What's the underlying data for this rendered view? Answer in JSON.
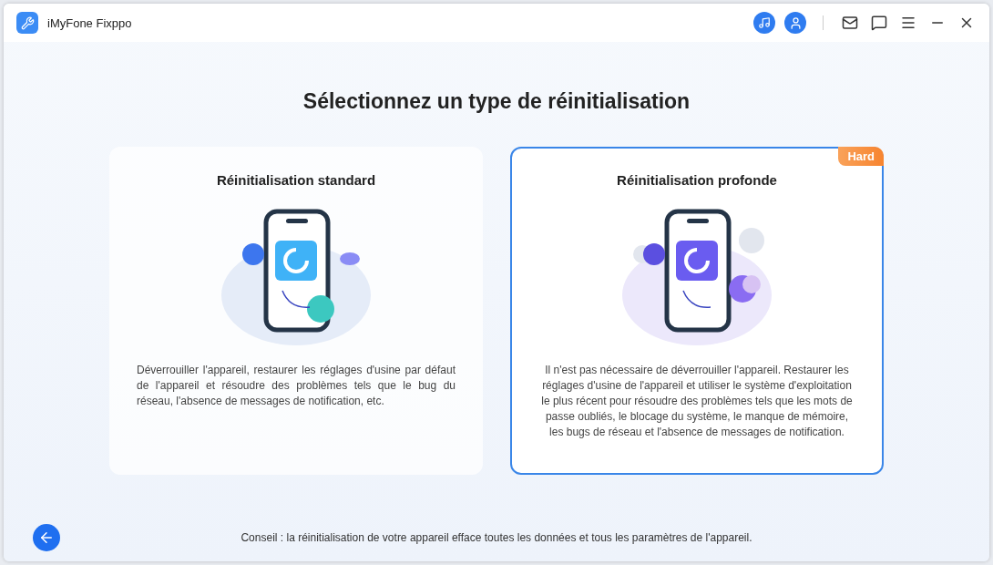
{
  "window": {
    "title": "iMyFone Fixppo"
  },
  "heading": "Sélectionnez un type de réinitialisation",
  "cards": [
    {
      "kind": "standard",
      "title": "Réinitialisation standard",
      "selected": false,
      "description": "Déverrouiller l'appareil,  restaurer les réglages d'usine par défaut de l'appareil et résoudre des problèmes tels que le bug du réseau, l'absence de messages de notification, etc."
    },
    {
      "kind": "deep",
      "title": "Réinitialisation profonde",
      "selected": true,
      "badge": "Hard",
      "description": "Il n'est pas nécessaire de déverrouiller l'appareil. Restaurer les réglages d'usine de l'appareil et utiliser le système d'exploitation le plus récent pour résoudre des problèmes tels que les mots de passe oubliés, le blocage du système, le manque de mémoire, les bugs de réseau et l'absence de messages de notification."
    }
  ],
  "footer": {
    "tip": "Conseil : la réinitialisation de votre appareil efface toutes les données et tous les paramètres de l'appareil."
  }
}
